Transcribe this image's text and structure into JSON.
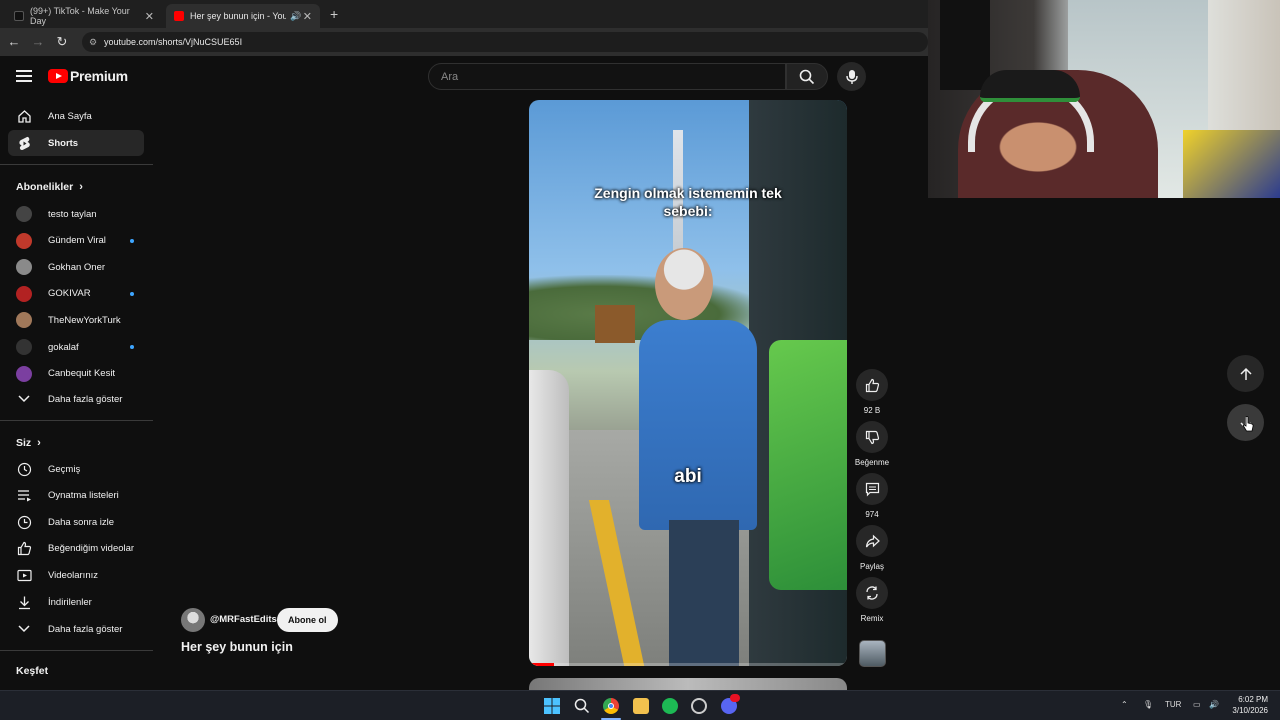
{
  "browser": {
    "tabs": [
      {
        "title": "(99+) TikTok - Make Your Day",
        "active": false
      },
      {
        "title": "Her şey bunun için - YouTube",
        "active": true
      }
    ],
    "new_tab_label": "+",
    "url": "youtube.com/shorts/VjNuCSUE65I"
  },
  "header": {
    "brand": "Premium",
    "search_placeholder": "Ara"
  },
  "sidebar": {
    "main": [
      {
        "label": "Ana Sayfa",
        "icon": "home-icon",
        "active": false
      },
      {
        "label": "Shorts",
        "icon": "shorts-icon",
        "active": true
      }
    ],
    "subscriptions_title": "Abonelikler",
    "subscriptions": [
      {
        "label": "testo taylan",
        "new": false,
        "color": "#444444"
      },
      {
        "label": "Gündem Viral",
        "new": true,
        "color": "#c0392b"
      },
      {
        "label": "Gokhan Oner",
        "new": false,
        "color": "#8a8a8a"
      },
      {
        "label": "GOKIVAR",
        "new": true,
        "color": "#b22222"
      },
      {
        "label": "TheNewYorkTurk",
        "new": false,
        "color": "#a0785a"
      },
      {
        "label": "gokalaf",
        "new": true,
        "color": "#333333"
      },
      {
        "label": "Canbequit Kesit",
        "new": false,
        "color": "#7b3fa0"
      }
    ],
    "show_more_1": "Daha fazla göster",
    "you_title": "Siz",
    "you_items": [
      {
        "label": "Geçmiş",
        "icon": "history-icon"
      },
      {
        "label": "Oynatma listeleri",
        "icon": "playlists-icon"
      },
      {
        "label": "Daha sonra izle",
        "icon": "watch-later-icon"
      },
      {
        "label": "Beğendiğim videolar",
        "icon": "liked-videos-icon"
      },
      {
        "label": "Videolarınız",
        "icon": "your-videos-icon"
      },
      {
        "label": "İndirilenler",
        "icon": "downloads-icon"
      }
    ],
    "show_more_2": "Daha fazla göster",
    "explore_title": "Keşfet"
  },
  "short": {
    "caption_top": "Zengin olmak istememin tek sebebi:",
    "caption_sub": "abi",
    "progress": 0.08,
    "channel": "@MRFastEdits",
    "subscribe_label": "Abone ol",
    "title": "Her şey bunun için"
  },
  "actions": {
    "like_count": "92 B",
    "dislike_label": "Beğenme",
    "comment_count": "974",
    "share_label": "Paylaş",
    "remix_label": "Remix"
  },
  "taskbar": {
    "language": "TUR",
    "time": "6:02 PM",
    "date": "3/10/2026"
  }
}
